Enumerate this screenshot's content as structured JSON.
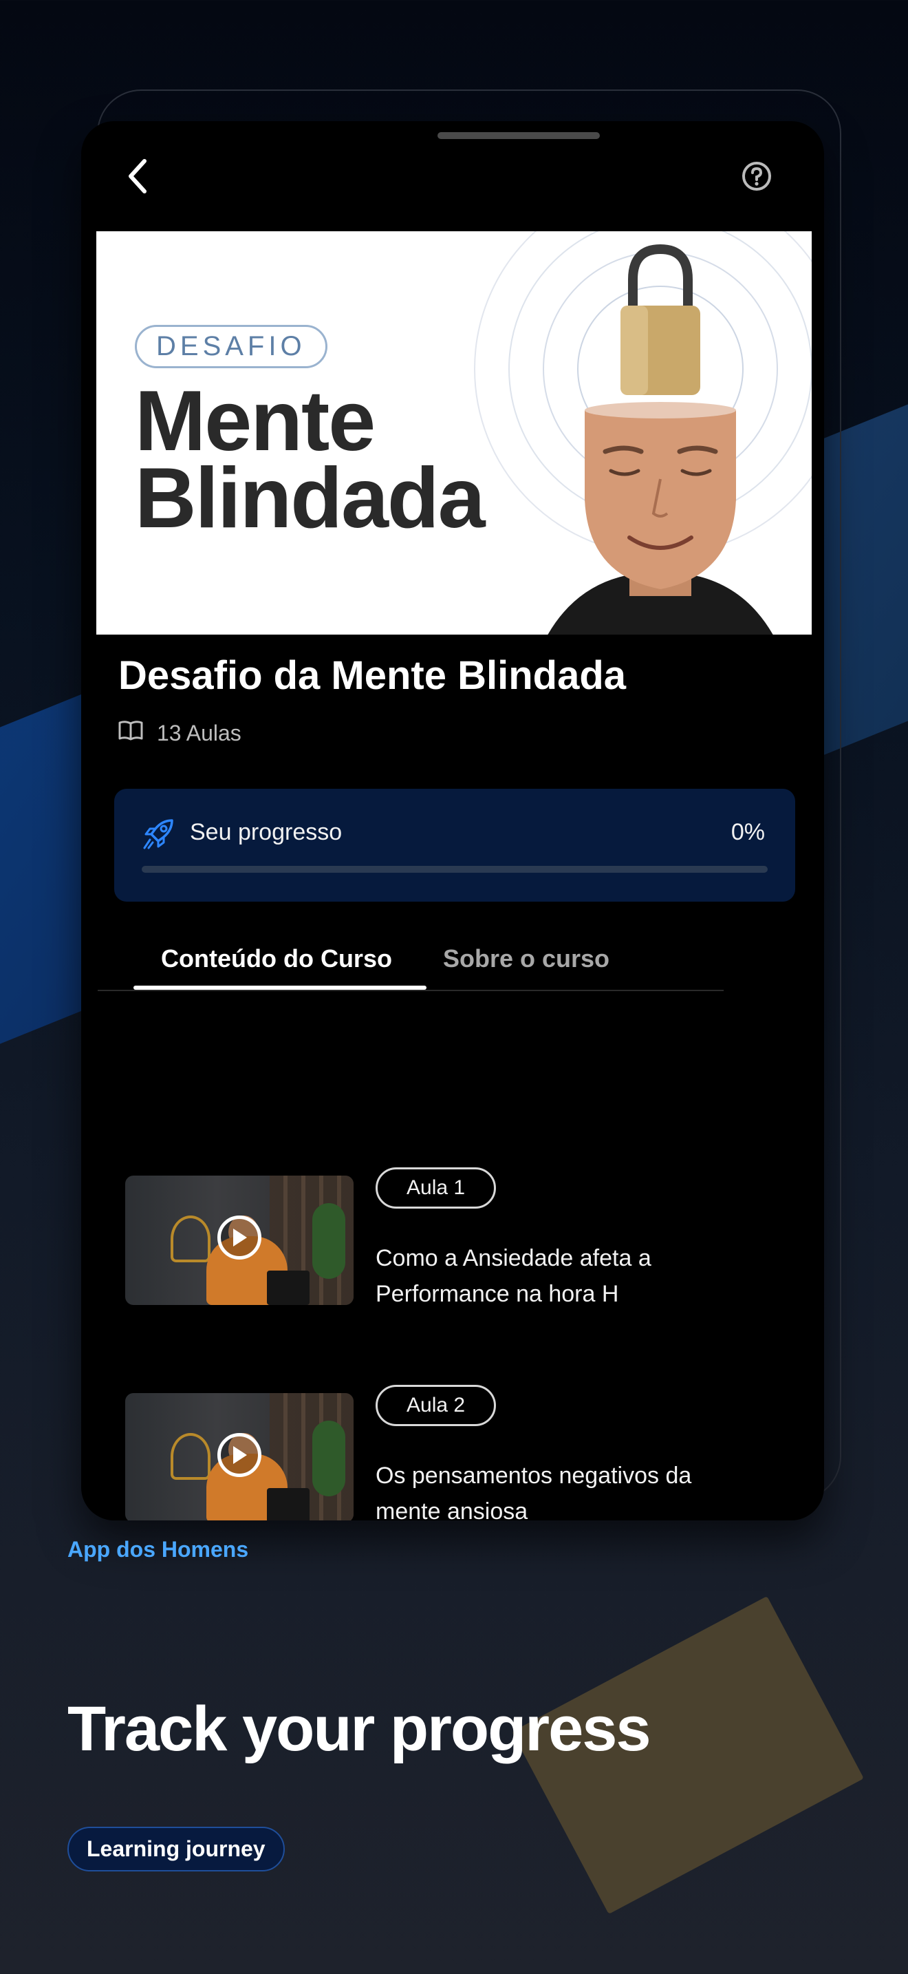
{
  "banner": {
    "badge": "DESAFIO",
    "title_line1": "Mente",
    "title_line2": "Blindada"
  },
  "course": {
    "title": "Desafio da Mente Blindada",
    "lessons_count": "13 Aulas"
  },
  "progress": {
    "label": "Seu progresso",
    "value_text": "0%",
    "fraction": 0
  },
  "tabs": [
    {
      "label": "Conteúdo do Curso",
      "active": true
    },
    {
      "label": "Sobre o curso",
      "active": false
    }
  ],
  "lessons": [
    {
      "chip": "Aula 1",
      "title": "Como a Ansiedade afeta a Performance na hora H"
    },
    {
      "chip": "Aula 2",
      "title": "Os pensamentos negativos da mente ansiosa"
    }
  ],
  "footer": {
    "app_name": "App dos Homens",
    "headline": "Track your progress",
    "pill": "Learning journey"
  },
  "icons": {
    "back": "chevron-left-icon",
    "help": "help-circle-icon",
    "book": "book-open-icon",
    "progress": "rocket-icon",
    "play": "play-icon"
  },
  "colors": {
    "accent": "#4aa7ff",
    "progress_card": "#061a3d",
    "rocket": "#2d86ff"
  }
}
